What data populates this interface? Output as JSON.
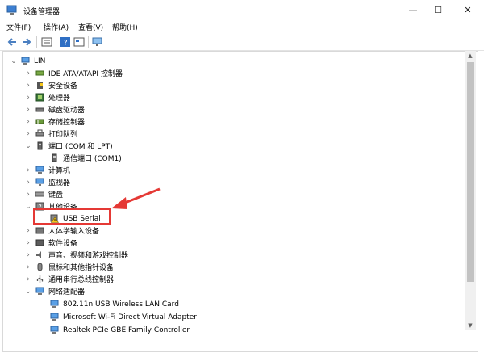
{
  "window": {
    "title": "设备管理器"
  },
  "controls": {
    "minimize": "—",
    "maximize": "☐",
    "close": "✕"
  },
  "menu": [
    {
      "label": "文件(F)"
    },
    {
      "label": "操作(A)"
    },
    {
      "label": "查看(V)"
    },
    {
      "label": "帮助(H)"
    }
  ],
  "tree": {
    "root": {
      "label": "LIN"
    },
    "items": [
      {
        "label": "IDE ATA/ATAPI 控制器"
      },
      {
        "label": "安全设备"
      },
      {
        "label": "处理器"
      },
      {
        "label": "磁盘驱动器"
      },
      {
        "label": "存储控制器"
      },
      {
        "label": "打印队列"
      },
      {
        "label": "端口 (COM 和 LPT)"
      },
      {
        "label": "通信端口 (COM1)"
      },
      {
        "label": "计算机"
      },
      {
        "label": "监视器"
      },
      {
        "label": "键盘"
      },
      {
        "label": "其他设备"
      },
      {
        "label": "USB Serial"
      },
      {
        "label": "人体学输入设备"
      },
      {
        "label": "软件设备"
      },
      {
        "label": "声音、视频和游戏控制器"
      },
      {
        "label": "鼠标和其他指针设备"
      },
      {
        "label": "通用串行总线控制器"
      },
      {
        "label": "网络适配器"
      },
      {
        "label": "802.11n USB Wireless LAN Card"
      },
      {
        "label": "Microsoft Wi-Fi Direct Virtual Adapter"
      },
      {
        "label": "Realtek PCIe GBE Family Controller"
      }
    ]
  },
  "colors": {
    "annotation": "#e53935",
    "warning": "#f5c518"
  }
}
